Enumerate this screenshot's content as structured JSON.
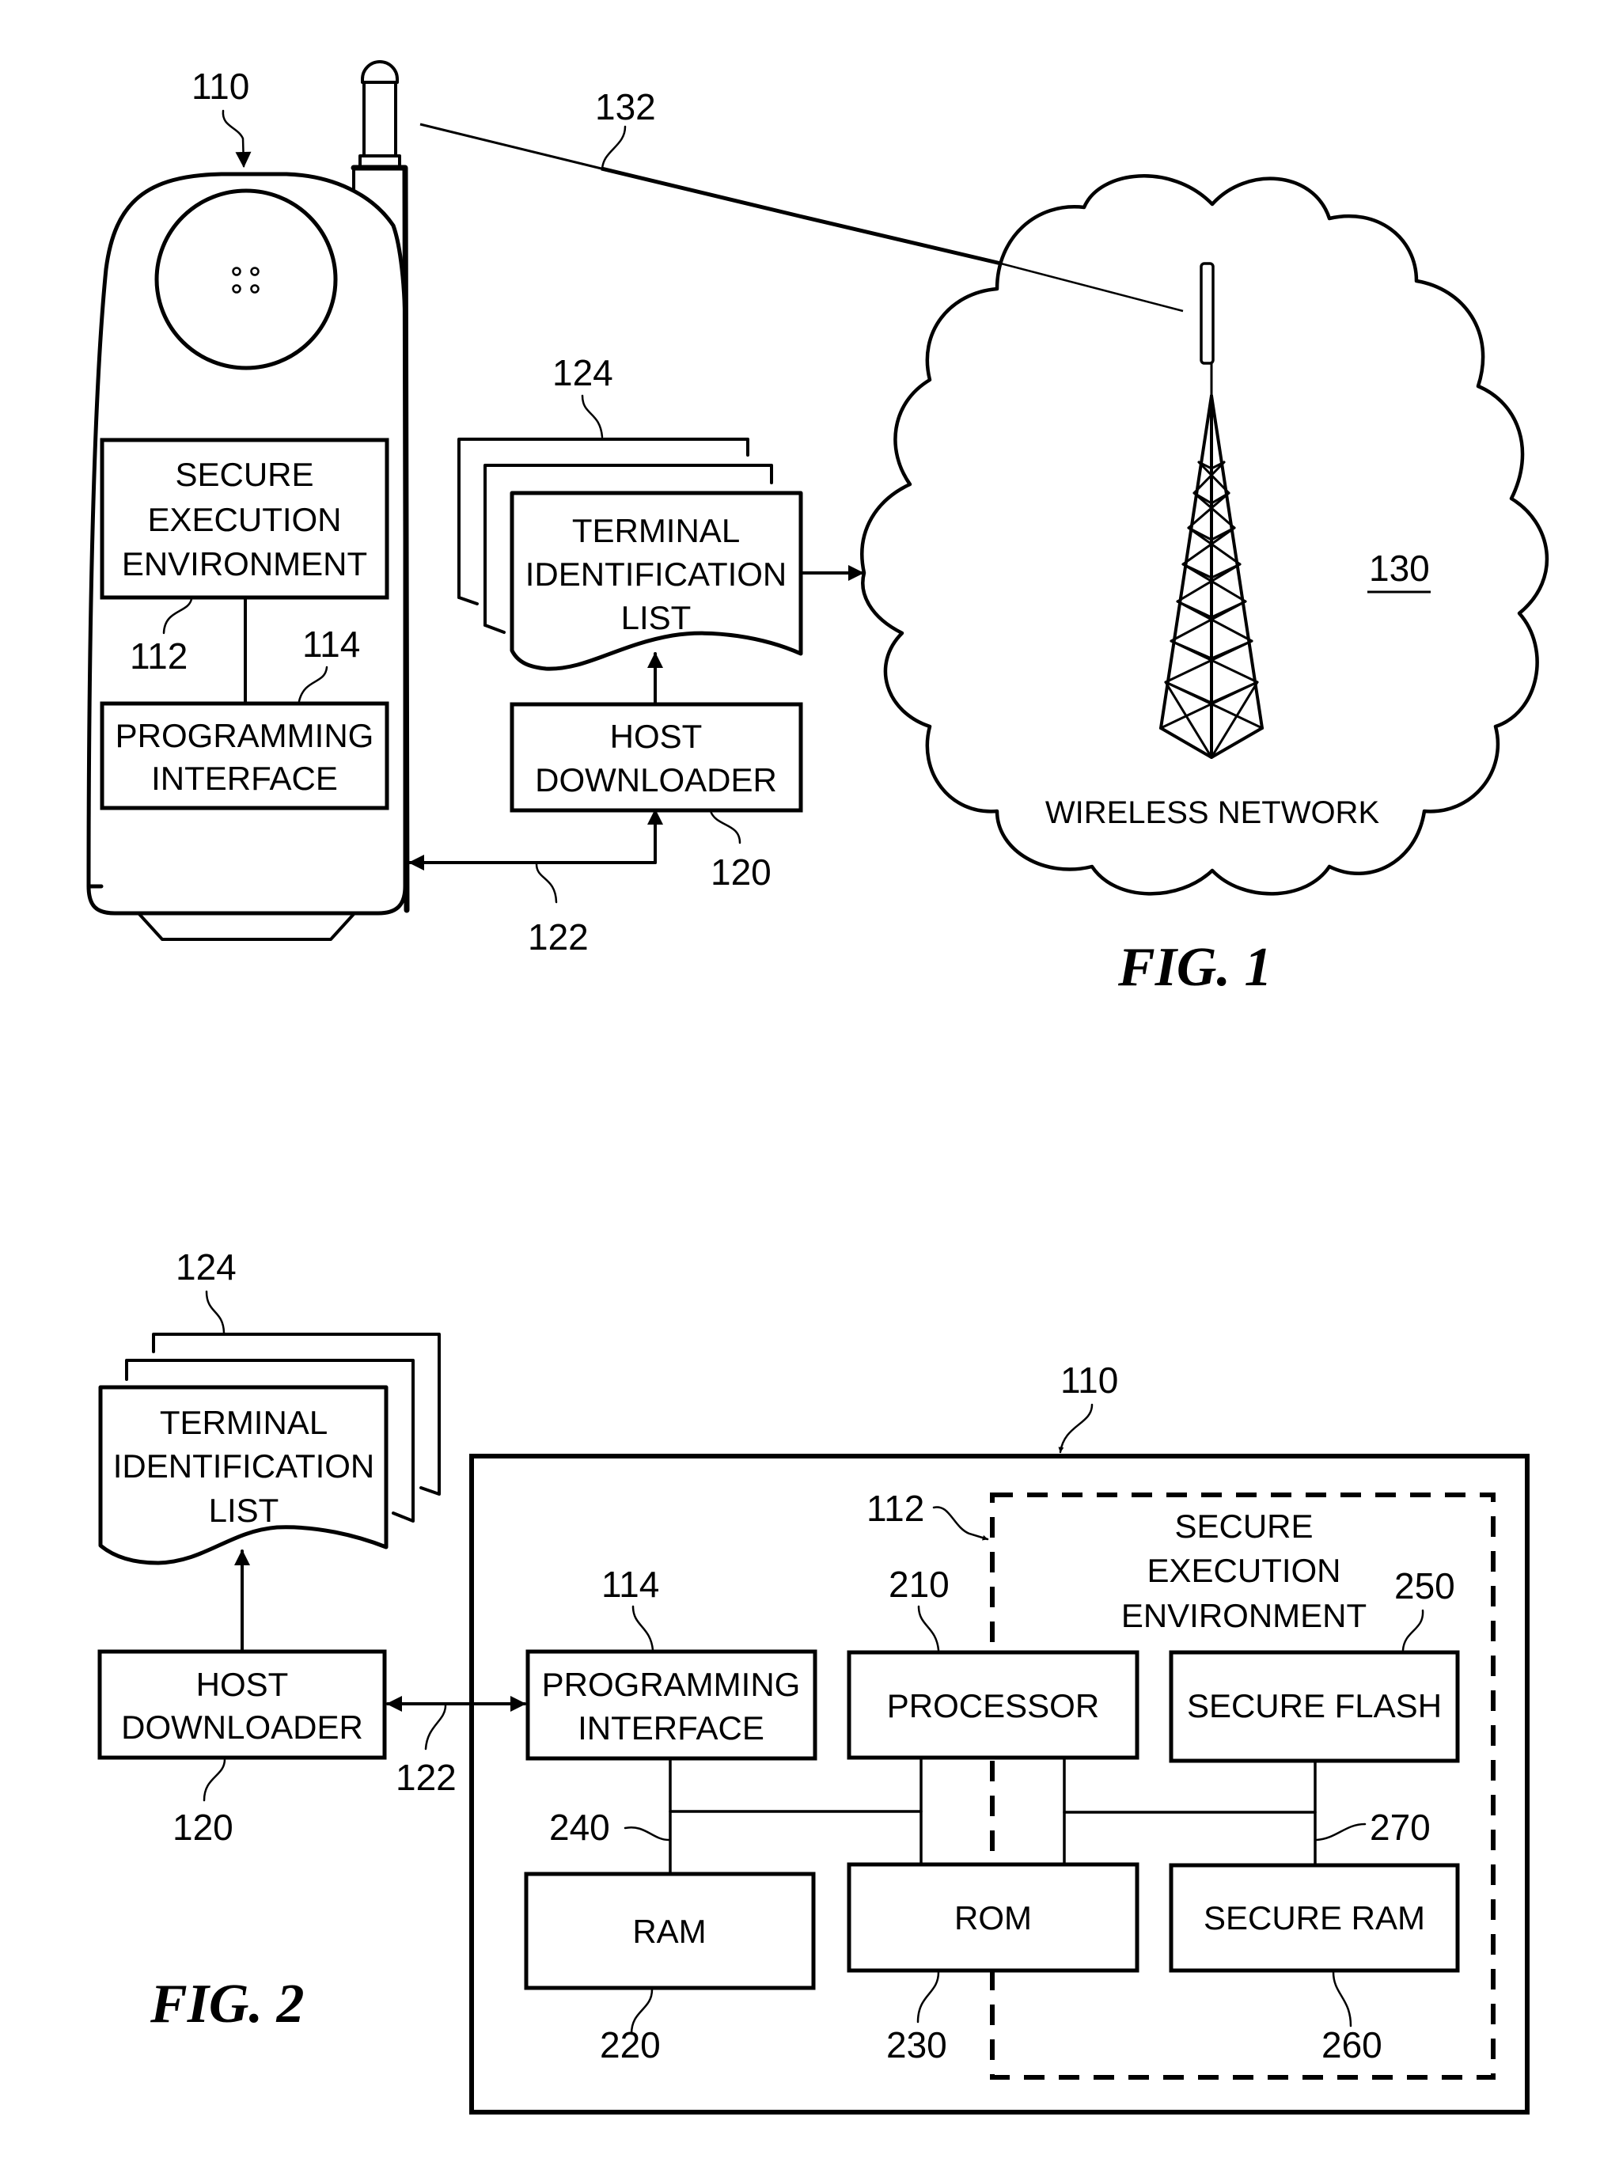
{
  "figures": {
    "fig1": {
      "caption": "FIG. 1",
      "device": {
        "ref": "110",
        "secure_env": {
          "lines": [
            "SECURE",
            "EXECUTION",
            "ENVIRONMENT"
          ],
          "ref": "112"
        },
        "prog_interface": {
          "lines": [
            "PROGRAMMING",
            "INTERFACE"
          ],
          "ref": "114"
        }
      },
      "terminal_list": {
        "lines": [
          "TERMINAL",
          "IDENTIFICATION",
          "LIST"
        ],
        "ref": "124"
      },
      "host_downloader": {
        "lines": [
          "HOST",
          "DOWNLOADER"
        ],
        "ref": "120"
      },
      "link_ref": "122",
      "wireless_link_ref": "132",
      "network": {
        "label": "WIRELESS NETWORK",
        "ref": "130"
      }
    },
    "fig2": {
      "caption": "FIG. 2",
      "terminal_list": {
        "lines": [
          "TERMINAL",
          "IDENTIFICATION",
          "LIST"
        ],
        "ref": "124"
      },
      "host_downloader": {
        "lines": [
          "HOST",
          "DOWNLOADER"
        ],
        "ref": "120"
      },
      "link_ref": "122",
      "device_ref": "110",
      "secure_env": {
        "lines": [
          "SECURE",
          "EXECUTION",
          "ENVIRONMENT"
        ],
        "ref": "112"
      },
      "blocks": {
        "prog_interface": {
          "lines": [
            "PROGRAMMING",
            "INTERFACE"
          ],
          "ref": "114"
        },
        "processor": {
          "label": "PROCESSOR",
          "ref": "210"
        },
        "secure_flash": {
          "label": "SECURE FLASH",
          "ref": "250"
        },
        "ram": {
          "label": "RAM",
          "ref": "220"
        },
        "rom": {
          "label": "ROM",
          "ref": "230"
        },
        "secure_ram": {
          "label": "SECURE RAM",
          "ref": "260"
        }
      },
      "bus_refs": {
        "main_bus": "240",
        "secure_bus": "270"
      }
    }
  }
}
